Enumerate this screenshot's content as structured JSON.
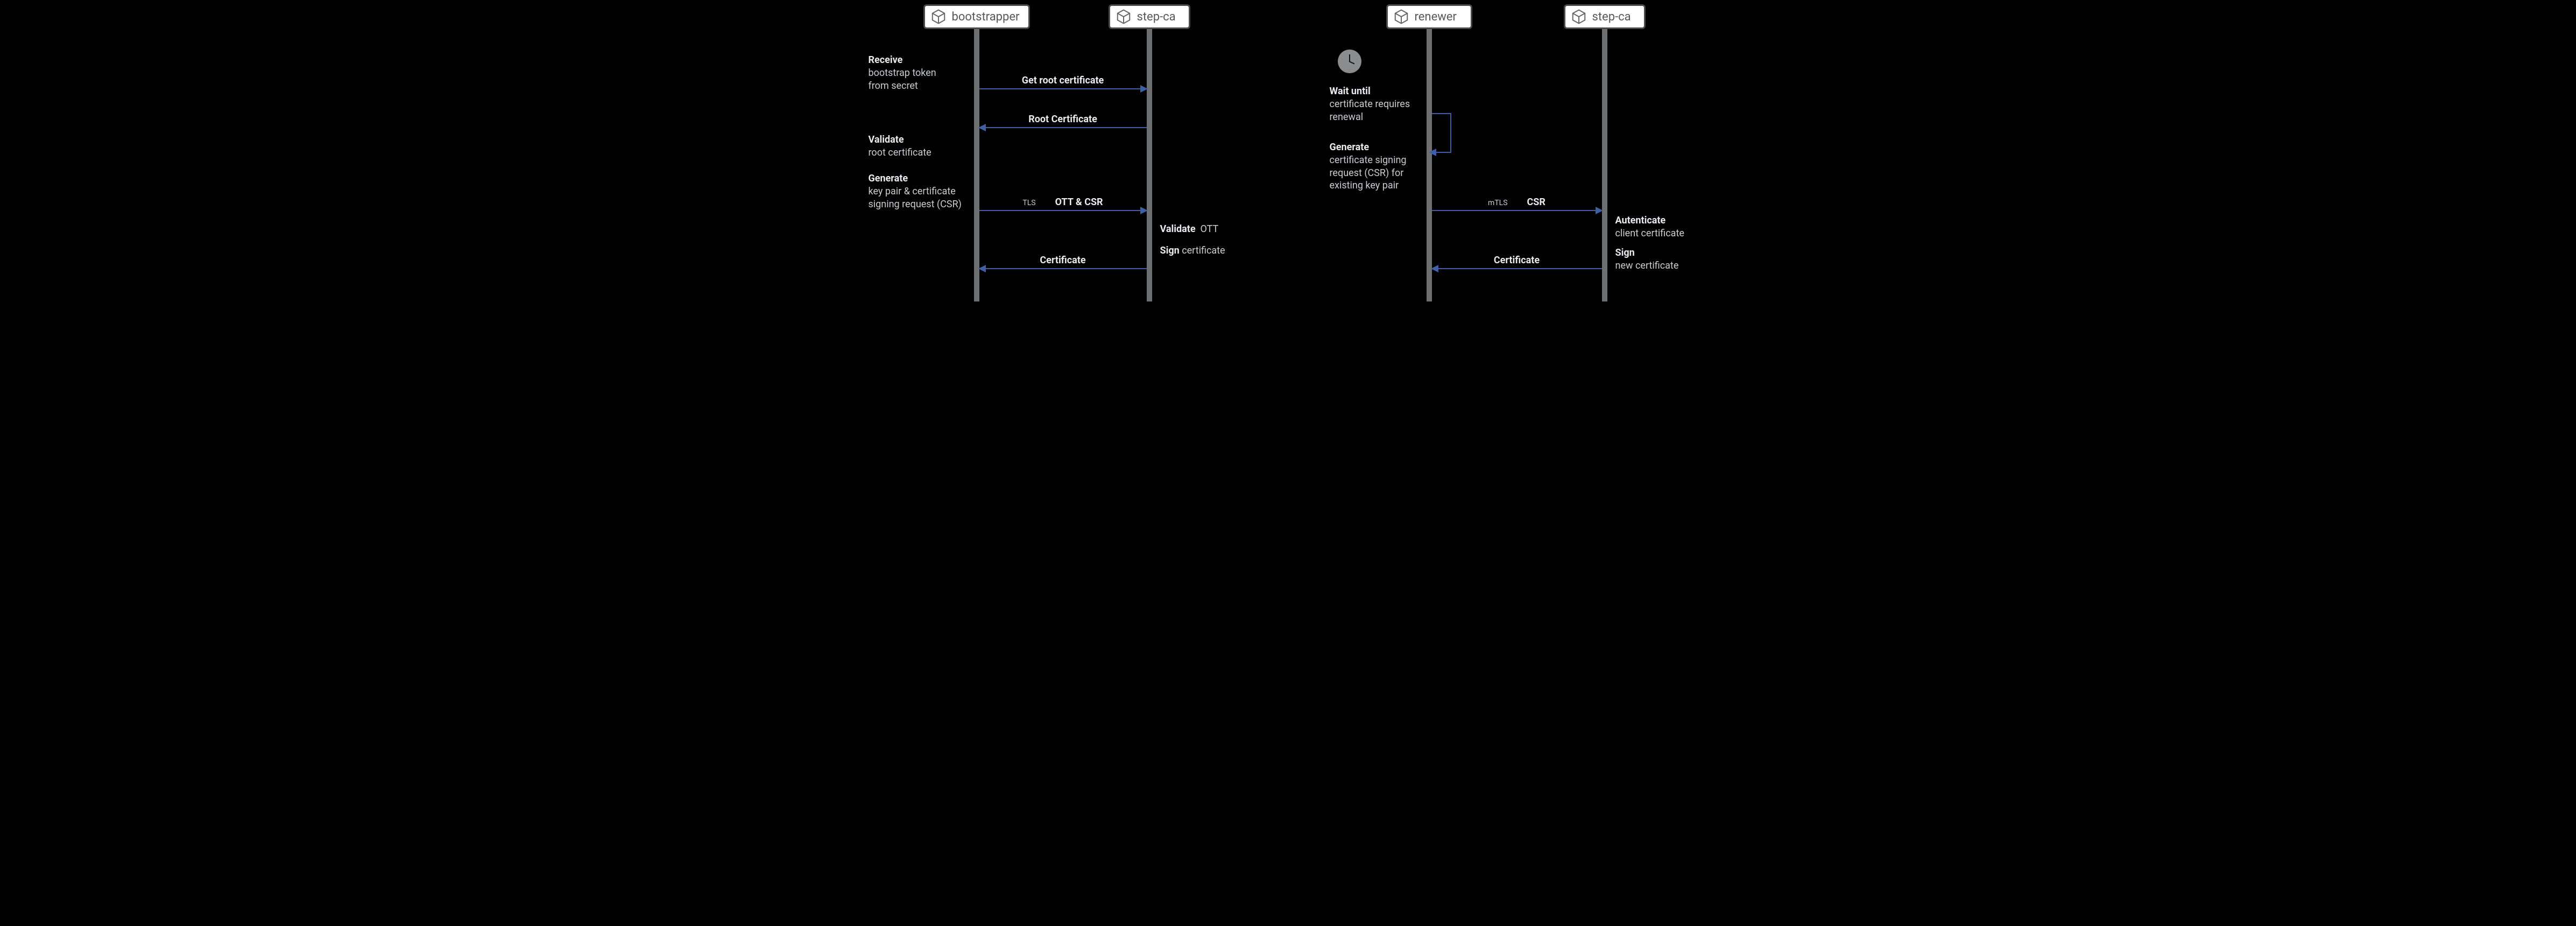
{
  "left": {
    "p1": "bootstrapper",
    "p2": "step-ca",
    "notes": {
      "receive_b": "Receive",
      "receive_t1": "bootstrap token",
      "receive_t2": "from secret",
      "validate_b": "Validate",
      "validate_t": "root certificate",
      "generate_b": "Generate",
      "generate_t1": "key pair & certificate",
      "generate_t2": "signing request (CSR)",
      "validate2_b": "Validate",
      "validate2_t": "OTT",
      "sign_b": "Sign",
      "sign_t": "certificate"
    },
    "arrows": {
      "a1": "Get root certificate",
      "a2": "Root Certificate",
      "a3_tag": "TLS",
      "a3": "OTT & CSR",
      "a4": "Certificate"
    }
  },
  "right": {
    "p1": "renewer",
    "p2": "step-ca",
    "notes": {
      "wait_b": "Wait until",
      "wait_t1": "certificate requires",
      "wait_t2": "renewal",
      "gen_b": "Generate",
      "gen_t1": "certificate signing",
      "gen_t2": "request (CSR) for",
      "gen_t3": "existing key pair",
      "auth_b": "Autenticate",
      "auth_t": "client certificate",
      "sign_b": "Sign",
      "sign_t": "new certificate"
    },
    "arrows": {
      "a1_tag": "mTLS",
      "a1": "CSR",
      "a2": "Certificate"
    }
  }
}
